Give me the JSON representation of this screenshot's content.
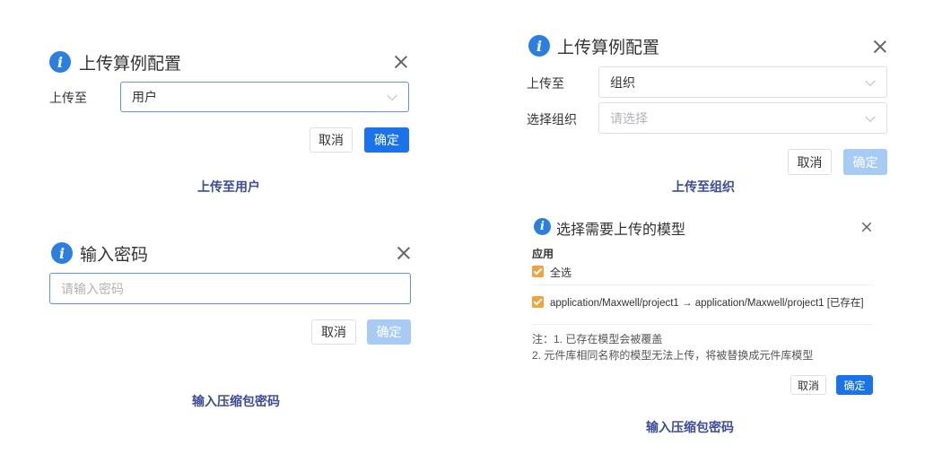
{
  "dialog_upload_user": {
    "title": "上传算例配置",
    "field_label": "上传至",
    "select_value": "用户",
    "cancel_label": "取消",
    "confirm_label": "确定",
    "caption": "上传至用户"
  },
  "dialog_upload_org": {
    "title": "上传算例配置",
    "upload_label": "上传至",
    "upload_value": "组织",
    "org_label": "选择组织",
    "org_placeholder": "请选择",
    "cancel_label": "取消",
    "confirm_label": "确定",
    "caption": "上传至组织"
  },
  "dialog_password": {
    "title": "输入密码",
    "input_placeholder": "请输入密码",
    "cancel_label": "取消",
    "confirm_label": "确定",
    "caption": "输入压缩包密码"
  },
  "dialog_models": {
    "title": "选择需要上传的模型",
    "section_label": "应用",
    "select_all_label": "全选",
    "item_label": "application/Maxwell/project1 → application/Maxwell/project1 [已存在]",
    "note_line1": "注：1. 已存在模型会被覆盖",
    "note_line2": "2. 元件库相同名称的模型无法上传，将被替换成元件库模型",
    "cancel_label": "取消",
    "confirm_label": "确定",
    "caption": "输入压缩包密码"
  },
  "icons": {
    "info": "info-icon",
    "close": "close-icon",
    "chevron": "chevron-down-icon",
    "check": "checkbox-checked-icon"
  },
  "colors": {
    "primary": "#1a73e8",
    "primary_disabled": "#a8cbf5",
    "info_icon": "#2a7fe0",
    "checkbox": "#f0a33a",
    "caption": "#3c4b9a"
  }
}
